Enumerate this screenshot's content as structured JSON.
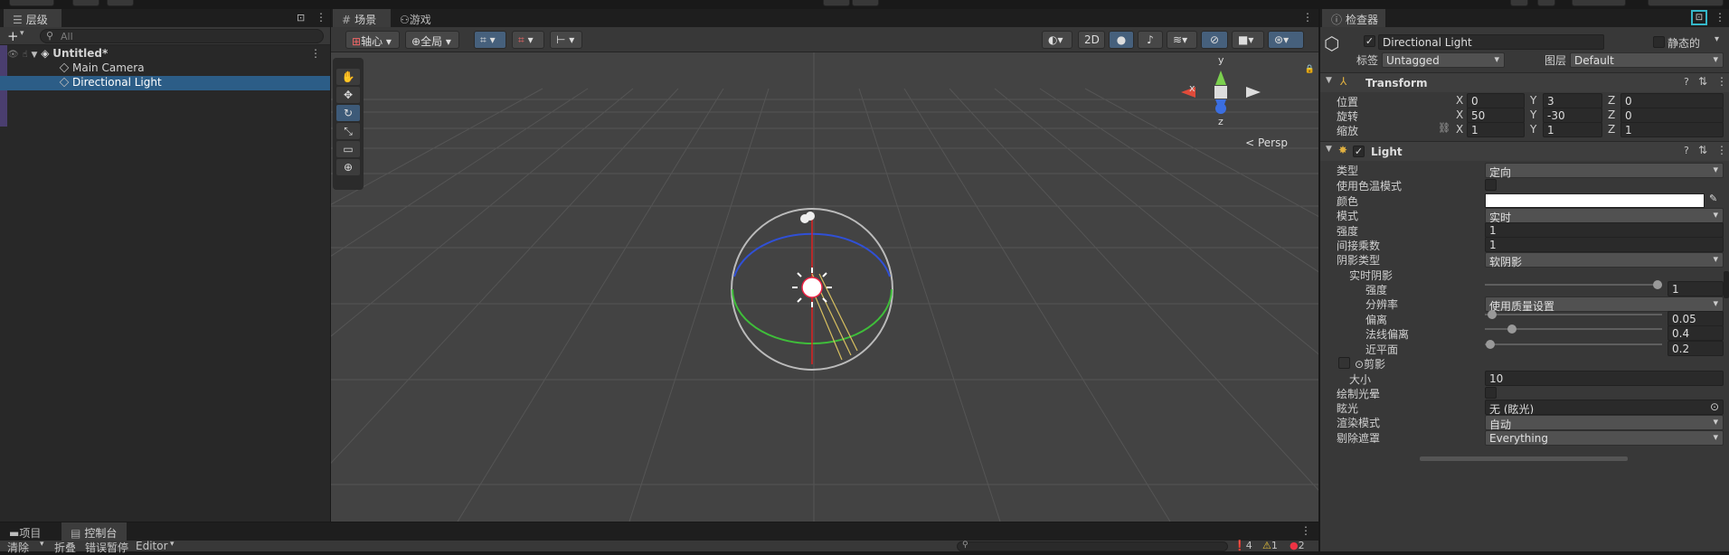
{
  "hierarchy": {
    "tab_title": "层级",
    "search_placeholder": "All",
    "scene_name": "Untitled*",
    "items": [
      {
        "label": "Main Camera"
      },
      {
        "label": "Directional Light"
      }
    ]
  },
  "scene_view": {
    "tabs": [
      {
        "label": "场景"
      },
      {
        "label": "游戏"
      }
    ],
    "pivot_label": "轴心",
    "global_label": "全局",
    "mode_2d": "2D",
    "persp_label": "< Persp",
    "axes": {
      "y": "y",
      "x": "x",
      "z": "z"
    }
  },
  "inspector": {
    "tab_title": "检查器",
    "object_name": "Directional Light",
    "static_label": "静态的",
    "tag_label": "标签",
    "tag_value": "Untagged",
    "layer_label": "图层",
    "layer_value": "Default",
    "transform": {
      "title": "Transform",
      "position": {
        "label": "位置",
        "x": "0",
        "y": "3",
        "z": "0"
      },
      "rotation": {
        "label": "旋转",
        "x": "50",
        "y": "-30",
        "z": "0"
      },
      "scale": {
        "label": "缩放",
        "x": "1",
        "y": "1",
        "z": "1"
      }
    },
    "light": {
      "title": "Light",
      "type_label": "类型",
      "type_value": "定向",
      "color_temp_label": "使用色温模式",
      "color_label": "颜色",
      "mode_label": "模式",
      "mode_value": "实时",
      "intensity_label": "强度",
      "intensity_value": "1",
      "indirect_label": "间接乘数",
      "indirect_value": "1",
      "shadow_type_label": "阴影类型",
      "shadow_type_value": "软阴影",
      "realtime_shadows_label": "实时阴影",
      "strength_label": "强度",
      "strength_value": "1",
      "resolution_label": "分辨率",
      "resolution_value": "使用质量设置",
      "bias_label": "偏离",
      "bias_value": "0.05",
      "normal_bias_label": "法线偏离",
      "normal_bias_value": "0.4",
      "near_plane_label": "近平面",
      "near_plane_value": "0.2",
      "cookie_label": "⊙剪影",
      "size_label": "大小",
      "size_value": "10",
      "draw_halo_label": "绘制光晕",
      "flare_label": "眩光",
      "flare_value": "无 (眩光)",
      "render_mode_label": "渲染模式",
      "render_mode_value": "自动",
      "culling_label": "剔除遮罩",
      "culling_value": "Everything"
    }
  },
  "bottom": {
    "tabs": [
      {
        "label": "项目"
      },
      {
        "label": "控制台"
      }
    ],
    "clear": "清除",
    "collapse": "折叠",
    "error_pause": "错误暂停",
    "editor": "Editor",
    "counts": {
      "info": "4",
      "warn": "1",
      "error": "2"
    }
  },
  "colors": {
    "selection": "#2c5d87",
    "accent": "#46607c",
    "highlight_outline": "#35b7c9"
  }
}
